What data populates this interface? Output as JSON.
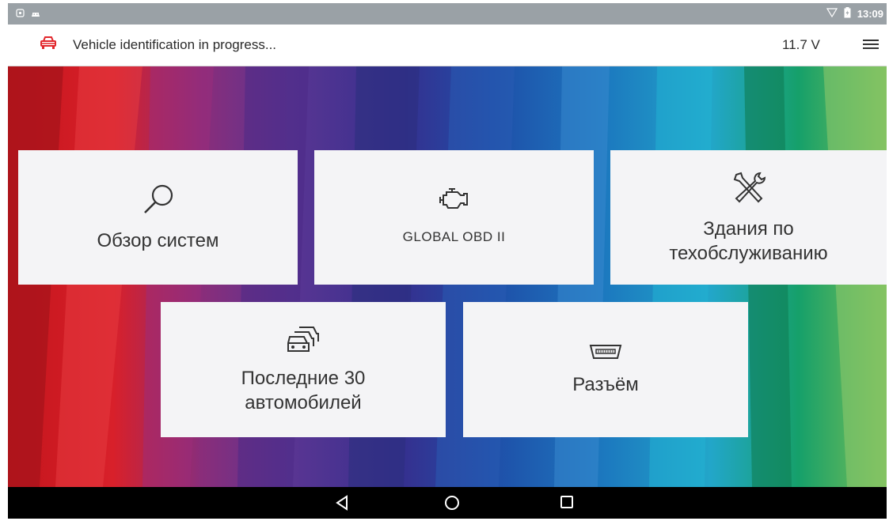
{
  "status_bar": {
    "time": "13:09",
    "icons": [
      "screenshot-icon",
      "android-icon",
      "wifi-icon",
      "battery-icon"
    ]
  },
  "app_bar": {
    "title": "Vehicle identification in progress...",
    "voltage": "11.7 V",
    "icons": [
      "car-icon",
      "menu-icon"
    ],
    "accent_color": "#e2262b"
  },
  "tiles": [
    {
      "id": "system-overview",
      "label": "Обзор систем",
      "icon": "search-icon"
    },
    {
      "id": "global-obd",
      "label": "GLOBAL OBD II",
      "icon": "engine-icon"
    },
    {
      "id": "maintenance",
      "label": "Здания по техобслуживанию",
      "icon": "tools-icon"
    },
    {
      "id": "last-vehicles",
      "label": "Последние 30 автомобилей",
      "icon": "cars-stack-icon"
    },
    {
      "id": "connector",
      "label": "Разъём",
      "icon": "connector-icon"
    }
  ],
  "nav_bar": {
    "icons": [
      "back-icon",
      "home-icon",
      "recents-icon"
    ]
  }
}
